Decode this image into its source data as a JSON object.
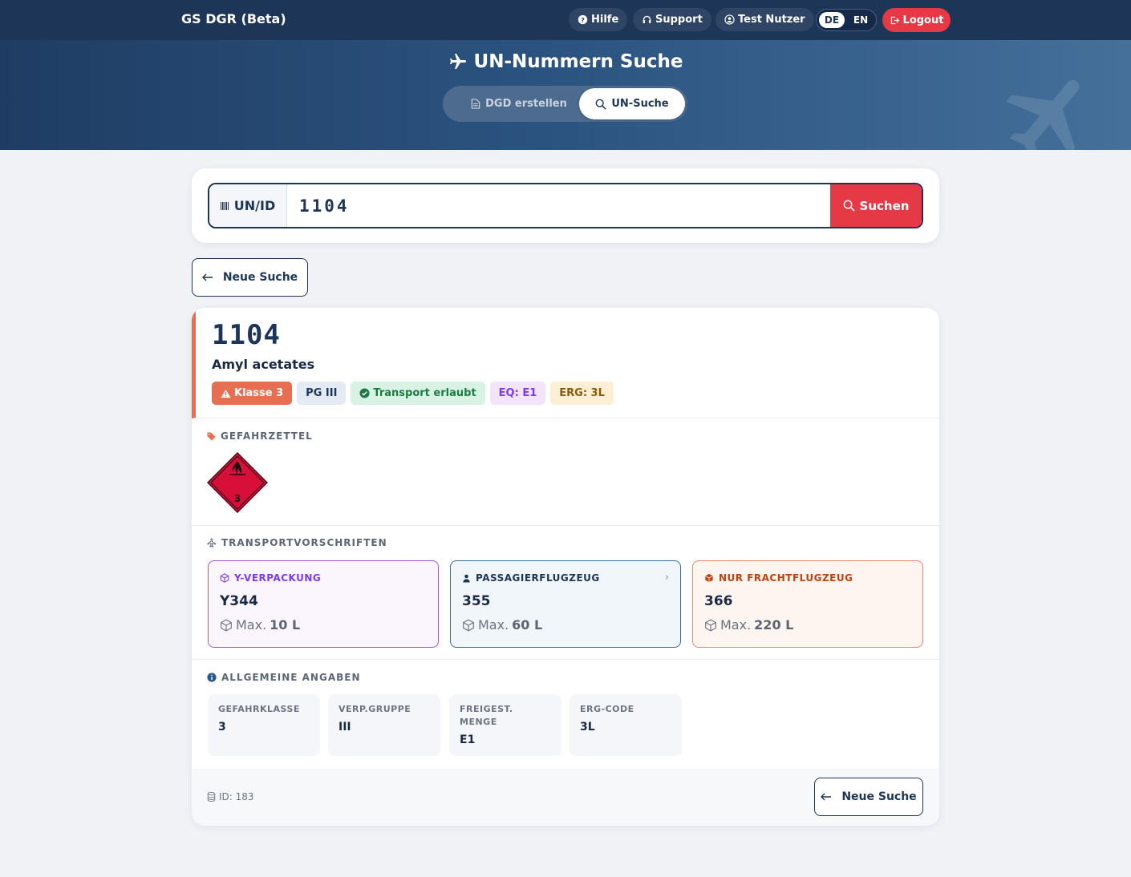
{
  "app": {
    "title": "GS DGR (Beta)"
  },
  "nav": {
    "help": "Hilfe",
    "support": "Support",
    "user": "Test Nutzer",
    "lang_de": "DE",
    "lang_en": "EN",
    "logout": "Logout"
  },
  "hero": {
    "title": "UN-Nummern Suche",
    "tab_dgd": "DGD erstellen",
    "tab_un": "UN-Suche"
  },
  "search": {
    "prefix": "UN/ID",
    "value": "1104",
    "button": "Suchen"
  },
  "back_label": "Neue Suche",
  "result": {
    "un_number": "1104",
    "name": "Amyl acetates",
    "badges": {
      "klasse": "Klasse 3",
      "pg": "PG III",
      "transport": "Transport erlaubt",
      "eq": "EQ: E1",
      "erg": "ERG: 3L"
    },
    "label_section": "GEFAHRZETTEL",
    "label_class_number": "3",
    "transport_section": "TRANSPORTVORSCHRIFTEN",
    "cards": [
      {
        "title": "Y-VERPACKUNG",
        "code": "Y344",
        "max_prefix": "Max.",
        "max_value": "10 L"
      },
      {
        "title": "PASSAGIERFLUGZEUG",
        "code": "355",
        "max_prefix": "Max.",
        "max_value": "60 L"
      },
      {
        "title": "NUR FRACHTFLUGZEUG",
        "code": "366",
        "max_prefix": "Max.",
        "max_value": "220 L"
      }
    ],
    "general_section": "ALLGEMEINE ANGABEN",
    "info": [
      {
        "label": "GEFAHRKLASSE",
        "value": "3"
      },
      {
        "label": "VERP.GRUPPE",
        "value": "III"
      },
      {
        "label": "FREIGEST. MENGE",
        "value": "E1"
      },
      {
        "label": "ERG-CODE",
        "value": "3L"
      }
    ],
    "footer_id": "ID: 183"
  },
  "colors": {
    "navy": "#1d3557",
    "red": "#e63946",
    "accent": "#e76f51",
    "purple": "#7c3aed",
    "blue": "#2a5a8a",
    "orange": "#c2410c"
  }
}
